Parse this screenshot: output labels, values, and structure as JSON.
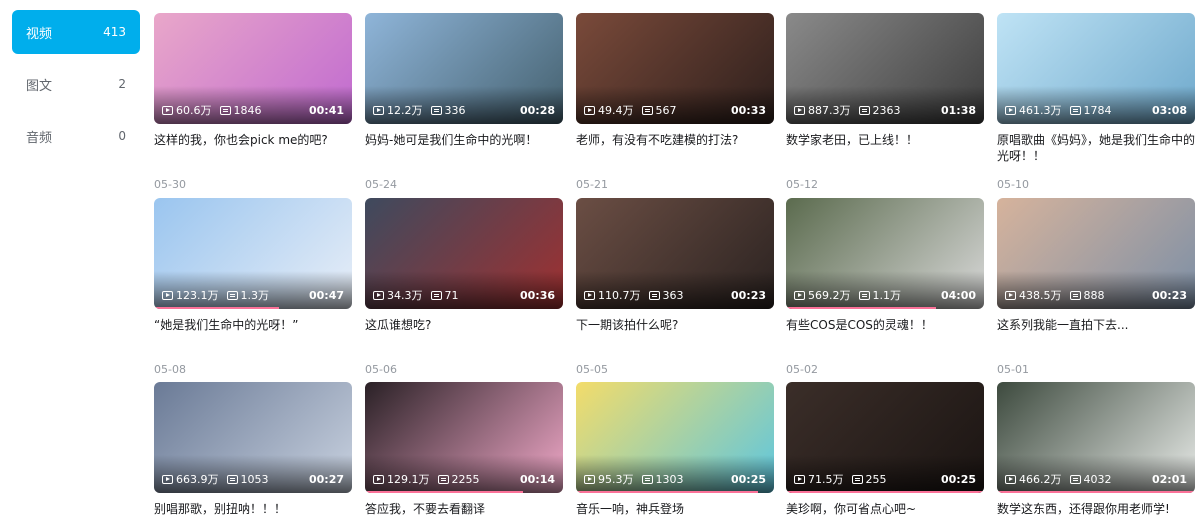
{
  "sidebar": {
    "items": [
      {
        "label": "视频",
        "count": "413",
        "active": true
      },
      {
        "label": "图文",
        "count": "2",
        "active": false
      },
      {
        "label": "音频",
        "count": "0",
        "active": false
      }
    ]
  },
  "videos": [
    {
      "views": "60.6万",
      "danmaku": "1846",
      "duration": "00:41",
      "title": "这样的我，你也会pick me的吧?",
      "date": "05-30",
      "bg": "#e9a7c9",
      "bg2": "#c06ad0",
      "progress": 0
    },
    {
      "views": "12.2万",
      "danmaku": "336",
      "duration": "00:28",
      "title": "妈妈-她可是我们生命中的光啊！",
      "date": "05-24",
      "bg": "#8fb5d9",
      "bg2": "#44606e",
      "progress": 0
    },
    {
      "views": "49.4万",
      "danmaku": "567",
      "duration": "00:33",
      "title": "老师，有没有不吃建模的打法?",
      "date": "05-21",
      "bg": "#7a4a3a",
      "bg2": "#2d1f1c",
      "progress": 0
    },
    {
      "views": "887.3万",
      "danmaku": "2363",
      "duration": "01:38",
      "title": "数学家老田，已上线！！",
      "date": "05-12",
      "bg": "#8a8a8a",
      "bg2": "#3d3d3d",
      "progress": 0
    },
    {
      "views": "461.3万",
      "danmaku": "1784",
      "duration": "03:08",
      "title": "原唱歌曲《妈妈》，她是我们生命中的光呀！！",
      "date": "05-10",
      "bg": "#bfe3f5",
      "bg2": "#6fa9cc",
      "progress": 0
    },
    {
      "views": "123.1万",
      "danmaku": "1.3万",
      "duration": "00:47",
      "title": "“她是我们生命中的光呀！”",
      "date": "05-08",
      "bg": "#9ac5ef",
      "bg2": "#e8eef7",
      "progress": 0.63
    },
    {
      "views": "34.3万",
      "danmaku": "71",
      "duration": "00:36",
      "title": "这瓜谁想吃?",
      "date": "05-06",
      "bg": "#3e4a5e",
      "bg2": "#a03030",
      "progress": 0
    },
    {
      "views": "110.7万",
      "danmaku": "363",
      "duration": "00:23",
      "title": "下一期该拍什么呢?",
      "date": "05-05",
      "bg": "#6b4e44",
      "bg2": "#2a2220",
      "progress": 0
    },
    {
      "views": "569.2万",
      "danmaku": "1.1万",
      "duration": "04:00",
      "title": "有些COS是COS的灵魂！！",
      "date": "05-02",
      "bg": "#5b6b4e",
      "bg2": "#d9d9d9",
      "progress": 0.76
    },
    {
      "views": "438.5万",
      "danmaku": "888",
      "duration": "00:23",
      "title": "这系列我能一直拍下去...",
      "date": "05-01",
      "bg": "#d6b39c",
      "bg2": "#7c8fa6",
      "progress": 0
    },
    {
      "views": "663.9万",
      "danmaku": "1053",
      "duration": "00:27",
      "title": "别唱那歌，别扭呐！！！",
      "date": "",
      "bg": "#6a7a96",
      "bg2": "#c9d2e0",
      "progress": 0
    },
    {
      "views": "129.1万",
      "danmaku": "2255",
      "duration": "00:14",
      "title": "答应我，不要去看翻译",
      "date": "",
      "bg": "#2a2126",
      "bg2": "#f2a9c9",
      "progress": 0.8
    },
    {
      "views": "95.3万",
      "danmaku": "1303",
      "duration": "00:25",
      "title": "音乐一响，神兵登场",
      "date": "",
      "bg": "#f3dc6a",
      "bg2": "#5cc6e0",
      "progress": 0.92
    },
    {
      "views": "71.5万",
      "danmaku": "255",
      "duration": "00:25",
      "title": "美珍啊，你可省点心吧~",
      "date": "",
      "bg": "#3b2e29",
      "bg2": "#1a1412",
      "progress": 1
    },
    {
      "views": "466.2万",
      "danmaku": "4032",
      "duration": "02:01",
      "title": "数学这东西，还得跟你用老师学!",
      "date": "",
      "bg": "#3d4a3e",
      "bg2": "#e9ece9",
      "progress": 1
    }
  ]
}
